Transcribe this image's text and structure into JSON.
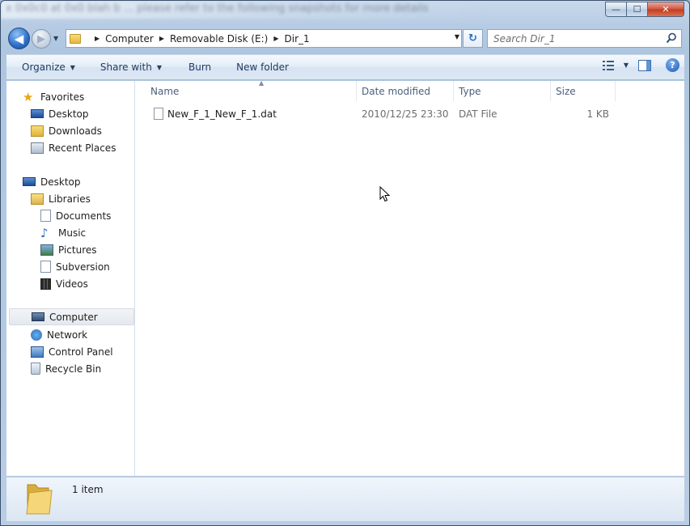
{
  "background_text": "x 0x0c0 at 0x0 blah b ... please refer to the following snapshots for more details",
  "window": {
    "minimize_label": "—",
    "maximize_label": "☐",
    "close_label": "✕"
  },
  "nav": {
    "back_glyph": "◀",
    "forward_glyph": "▶",
    "history_glyph": "▼",
    "breadcrumbs": [
      "Computer",
      "Removable Disk (E:)",
      "Dir_1"
    ],
    "refresh_glyph": "↻"
  },
  "search": {
    "placeholder": "Search Dir_1"
  },
  "toolbar": {
    "organize": "Organize",
    "share_with": "Share with",
    "burn": "Burn",
    "new_folder": "New folder",
    "help_glyph": "?"
  },
  "sidebar": {
    "favorites": "Favorites",
    "desktop_fav": "Desktop",
    "downloads": "Downloads",
    "recent_places": "Recent Places",
    "desktop": "Desktop",
    "libraries": "Libraries",
    "documents": "Documents",
    "music": "Music",
    "pictures": "Pictures",
    "subversion": "Subversion",
    "videos": "Videos",
    "computer": "Computer",
    "network": "Network",
    "control_panel": "Control Panel",
    "recycle_bin": "Recycle Bin"
  },
  "columns": {
    "name": "Name",
    "date_modified": "Date modified",
    "type": "Type",
    "size": "Size"
  },
  "files": [
    {
      "name": "New_F_1_New_F_1.dat",
      "date_modified": "2010/12/25 23:30",
      "type": "DAT File",
      "size": "1 KB"
    }
  ],
  "status": {
    "item_count": "1 item"
  },
  "colors": {
    "accent": "#2a6fc9",
    "chrome": "#b7cce4",
    "selection": "#e4e8ee"
  }
}
